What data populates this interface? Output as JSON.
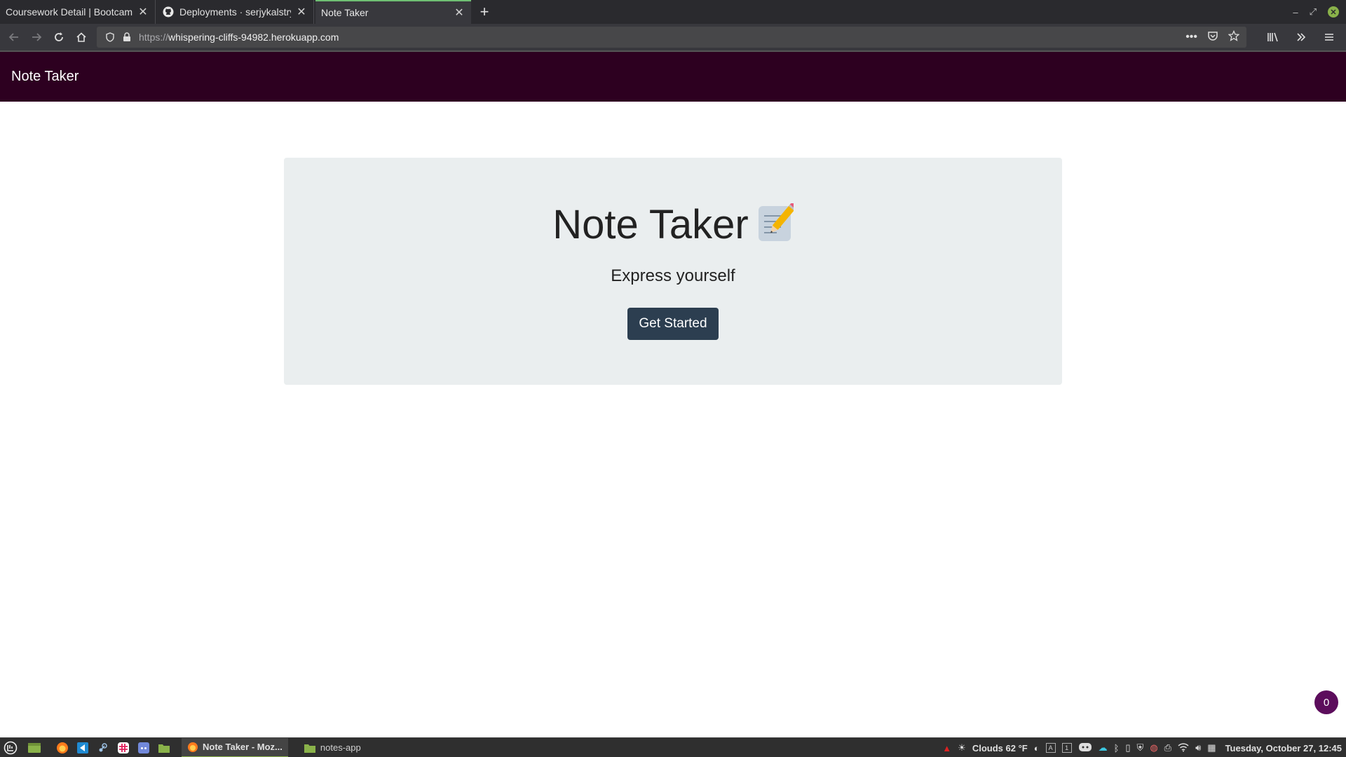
{
  "browser": {
    "tabs": [
      {
        "title": "Coursework Detail | Bootcamp",
        "active": false
      },
      {
        "title": "Deployments · serjykalstryk",
        "active": false
      },
      {
        "title": "Note Taker",
        "active": true
      }
    ],
    "new_tab_symbol": "+",
    "url_scheme": "https://",
    "url_host": "whispering-cliffs-94982.herokuapp.com"
  },
  "site": {
    "brand": "Note Taker",
    "hero_title": "Note Taker",
    "hero_subtitle": "Express yourself",
    "cta_label": "Get Started",
    "badge_count": "0",
    "colors": {
      "navbar": "#2d0020",
      "hero_bg": "#eaeeef",
      "cta": "#2c3e50",
      "badge": "#5c0d5c"
    }
  },
  "taskbar": {
    "windows": [
      {
        "label": "Note Taker - Moz...",
        "active": true,
        "icon": "firefox-icon"
      },
      {
        "label": "notes-app",
        "active": false,
        "icon": "folder-icon"
      }
    ],
    "weather": "Clouds 62 °F",
    "kbd_a": "A",
    "kbd_1": "1",
    "clock": "Tuesday, October 27, 12:45"
  }
}
